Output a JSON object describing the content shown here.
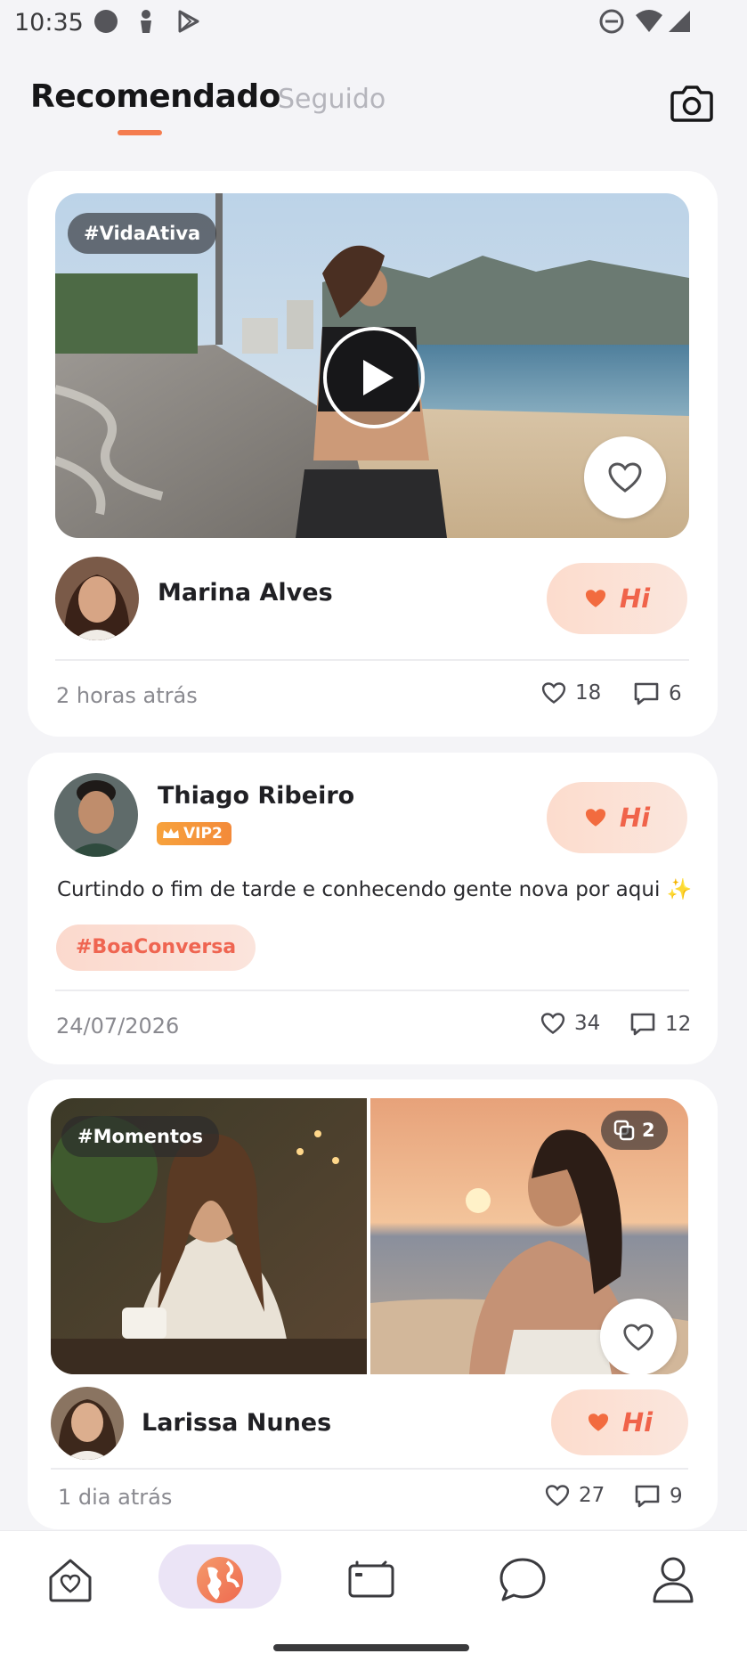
{
  "status_bar": {
    "time": "10:35"
  },
  "header": {
    "tab_recommended": "Recomendado",
    "tab_following": "Seguido",
    "accent_color": "#f47c4f"
  },
  "posts": [
    {
      "hashtag_overlay": "#VidaAtiva",
      "user_name": "Marina Alves",
      "hi_label": "Hi",
      "time": "2 horas atrás",
      "likes": "18",
      "comments": "6",
      "media_type": "video"
    },
    {
      "user_name": "Thiago Ribeiro",
      "vip_label": "VIP2",
      "hi_label": "Hi",
      "text": "Curtindo o fim de tarde e conhecendo gente nova por aqui ✨",
      "hashtag": "#BoaConversa",
      "time": "24/07/2026",
      "likes": "34",
      "comments": "12"
    },
    {
      "hashtag_overlay": "#Momentos",
      "photo_count": "2",
      "user_name": "Larissa Nunes",
      "hi_label": "Hi",
      "time": "1 dia atrás",
      "likes": "27",
      "comments": "9"
    }
  ],
  "bottom_nav": {
    "items": [
      "home-icon",
      "explore-icon",
      "video-icon",
      "chat-icon",
      "profile-icon"
    ],
    "active": "explore-icon",
    "active_color": "#ebe4f6"
  }
}
